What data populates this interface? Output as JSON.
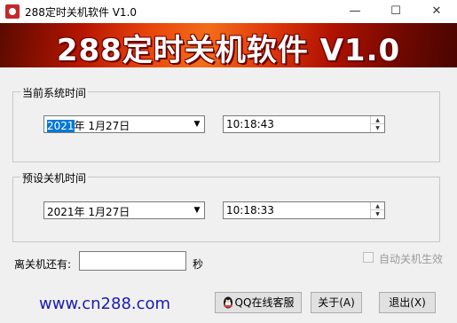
{
  "window": {
    "title": "288定时关机软件 V1.0",
    "minimize_glyph": "—",
    "maximize_glyph": "☐",
    "close_glyph": "✕"
  },
  "banner": {
    "title": "288定时关机软件 V1.0"
  },
  "current_time_group": {
    "label": "当前系统时间",
    "date_year": "2021",
    "date_rest": "年  1月27日",
    "time": "10:18:43"
  },
  "shutdown_time_group": {
    "label": "预设关机时间",
    "date": "2021年  1月27日",
    "time": "10:18:33"
  },
  "remaining": {
    "label": "离关机还有:",
    "value": "",
    "unit": "秒"
  },
  "auto_shutdown": {
    "label": "自动关机生效",
    "checked": false
  },
  "footer": {
    "url": "www.cn288.com",
    "qq_button": "QQ在线客服",
    "about_button": "关于(A)",
    "exit_button": "退出(X)"
  },
  "colors": {
    "banner": "#d8360c",
    "url": "#1a1ab2",
    "selection": "#0078d7"
  }
}
